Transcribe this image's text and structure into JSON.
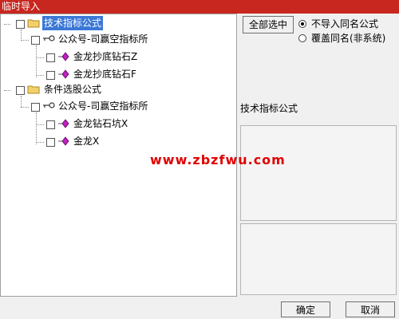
{
  "window": {
    "title": "临时导入"
  },
  "tree": {
    "groups": [
      {
        "label": "技术指标公式",
        "selected": true,
        "children": [
          {
            "label": "公众号-司赢空指标所",
            "items": [
              {
                "label": "金龙抄底钻石Z"
              },
              {
                "label": "金龙抄底钻石F"
              }
            ]
          }
        ]
      },
      {
        "label": "条件选股公式",
        "selected": false,
        "children": [
          {
            "label": "公众号-司赢空指标所",
            "items": [
              {
                "label": "金龙钻石坑X"
              },
              {
                "label": "金龙X"
              }
            ]
          }
        ]
      }
    ]
  },
  "right_panel": {
    "select_all_label": "全部选中",
    "options": [
      {
        "label": "不导入同名公式",
        "checked": true
      },
      {
        "label": "覆盖同名(非系统)",
        "checked": false
      }
    ],
    "section_title": "技术指标公式"
  },
  "watermark": "www.zbzfwu.com",
  "buttons": {
    "ok_label": "确定",
    "cancel_label": "取消"
  },
  "colors": {
    "titlebar": "#c8271f",
    "selection": "#3b78d6",
    "watermark": "#e00000",
    "gem": "#c020c0"
  }
}
